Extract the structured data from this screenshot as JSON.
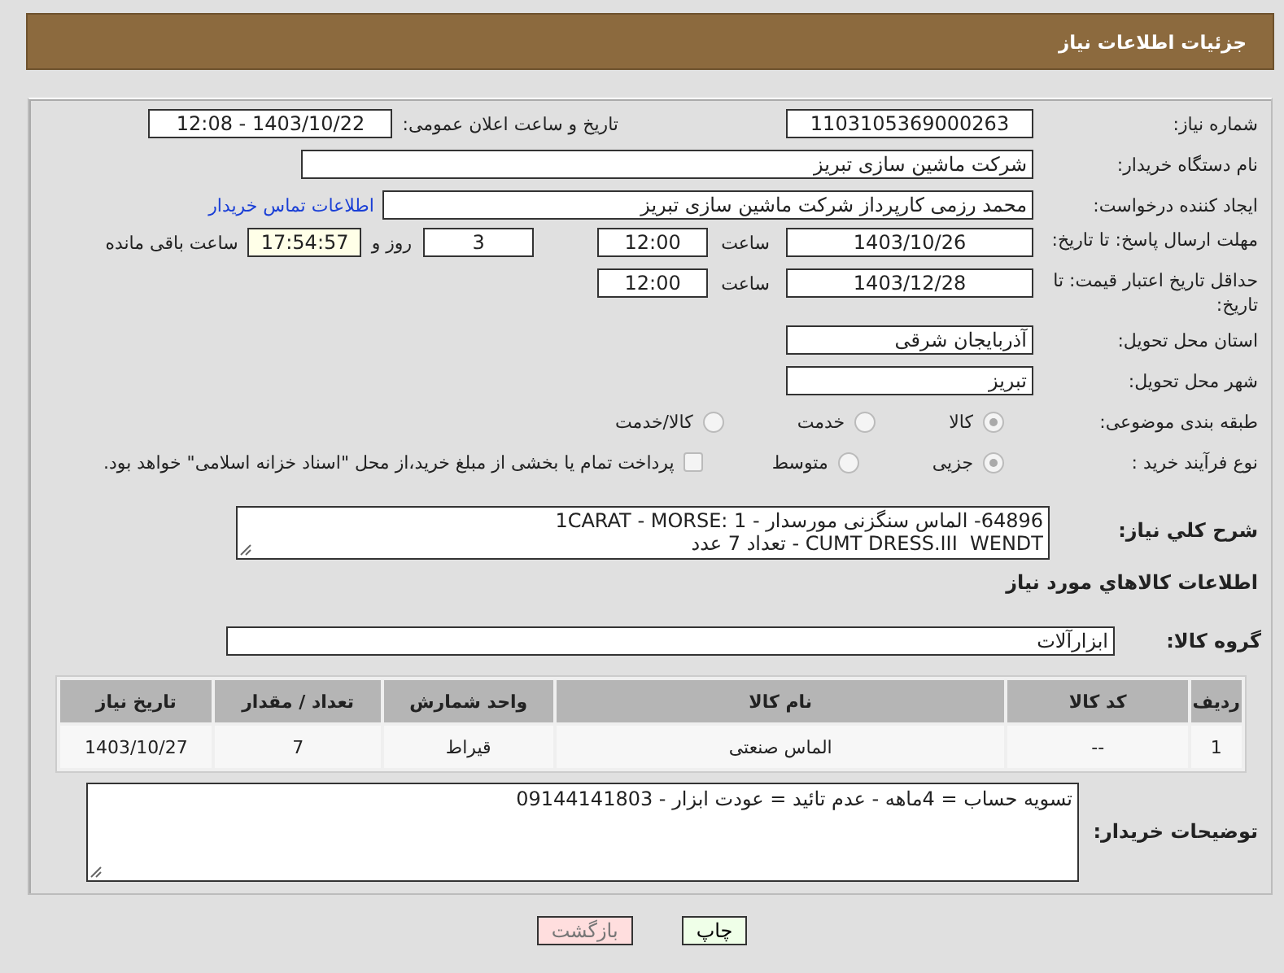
{
  "header": {
    "title": "جزئیات اطلاعات نیاز"
  },
  "need_number": {
    "label": "شماره نیاز:",
    "value": "1103105369000263"
  },
  "announce": {
    "label": "تاریخ و ساعت اعلان عمومی:",
    "value": "1403/10/22 - 12:08"
  },
  "buyer_org": {
    "label": "نام دستگاه خریدار:",
    "value": "شرکت ماشین سازی تبریز"
  },
  "requester": {
    "label": "ایجاد کننده درخواست:",
    "value": "محمد رزمی کارپرداز شرکت ماشین سازی تبریز",
    "link": "اطلاعات تماس خریدار"
  },
  "deadline": {
    "label": "مهلت ارسال پاسخ: تا تاریخ:",
    "date": "1403/10/26",
    "time_label": "ساعت",
    "time": "12:00",
    "days": "3",
    "days_label": "روز و",
    "remaining": "17:54:57",
    "remaining_label": "ساعت باقی مانده"
  },
  "validity": {
    "label": "حداقل تاریخ اعتبار قیمت: تا تاریخ:",
    "date": "1403/12/28",
    "time_label": "ساعت",
    "time": "12:00"
  },
  "province": {
    "label": "استان محل تحویل:",
    "value": "آذربایجان شرقی"
  },
  "city": {
    "label": "شهر محل تحویل:",
    "value": "تبریز"
  },
  "category": {
    "label": "طبقه بندی موضوعی:",
    "options": [
      {
        "label": "کالا",
        "selected": true
      },
      {
        "label": "خدمت",
        "selected": false
      },
      {
        "label": "کالا/خدمت",
        "selected": false
      }
    ]
  },
  "process": {
    "label": "نوع فرآیند خرید :",
    "options": [
      {
        "label": "جزیی",
        "selected": true
      },
      {
        "label": "متوسط",
        "selected": false
      }
    ],
    "payment": {
      "checked": false,
      "text": "پرداخت تمام یا بخشی از مبلغ خرید،از محل \"اسناد خزانه اسلامی\" خواهد بود."
    }
  },
  "description": {
    "label": "شرح کلي نیاز:",
    "lines": [
      "64896- الماس سنگزنی مورسدار - 1CARAT - MORSE: 1",
      "CUMT DRESS.III  WENDT - تعداد 7 عدد"
    ]
  },
  "goods_title": "اطلاعات كالاهاي مورد نیاز",
  "goods_group": {
    "label": "گروه کالا:",
    "value": "ابزارآلات"
  },
  "table": {
    "columns": [
      "ردیف",
      "کد کالا",
      "نام کالا",
      "واحد شمارش",
      "تعداد / مقدار",
      "تاریخ نیاز"
    ],
    "rows": [
      [
        "1",
        "--",
        "الماس صنعتی",
        "قیراط",
        "7",
        "1403/10/27"
      ]
    ]
  },
  "notes": {
    "label": "توضیحات خریدار:",
    "value": "تسویه حساب = 4ماهه - عدم تائید = عودت ابزار - 09144141803"
  },
  "buttons": [
    {
      "label": "چاپ",
      "kind": "print"
    },
    {
      "label": "بازگشت",
      "kind": "back"
    }
  ]
}
